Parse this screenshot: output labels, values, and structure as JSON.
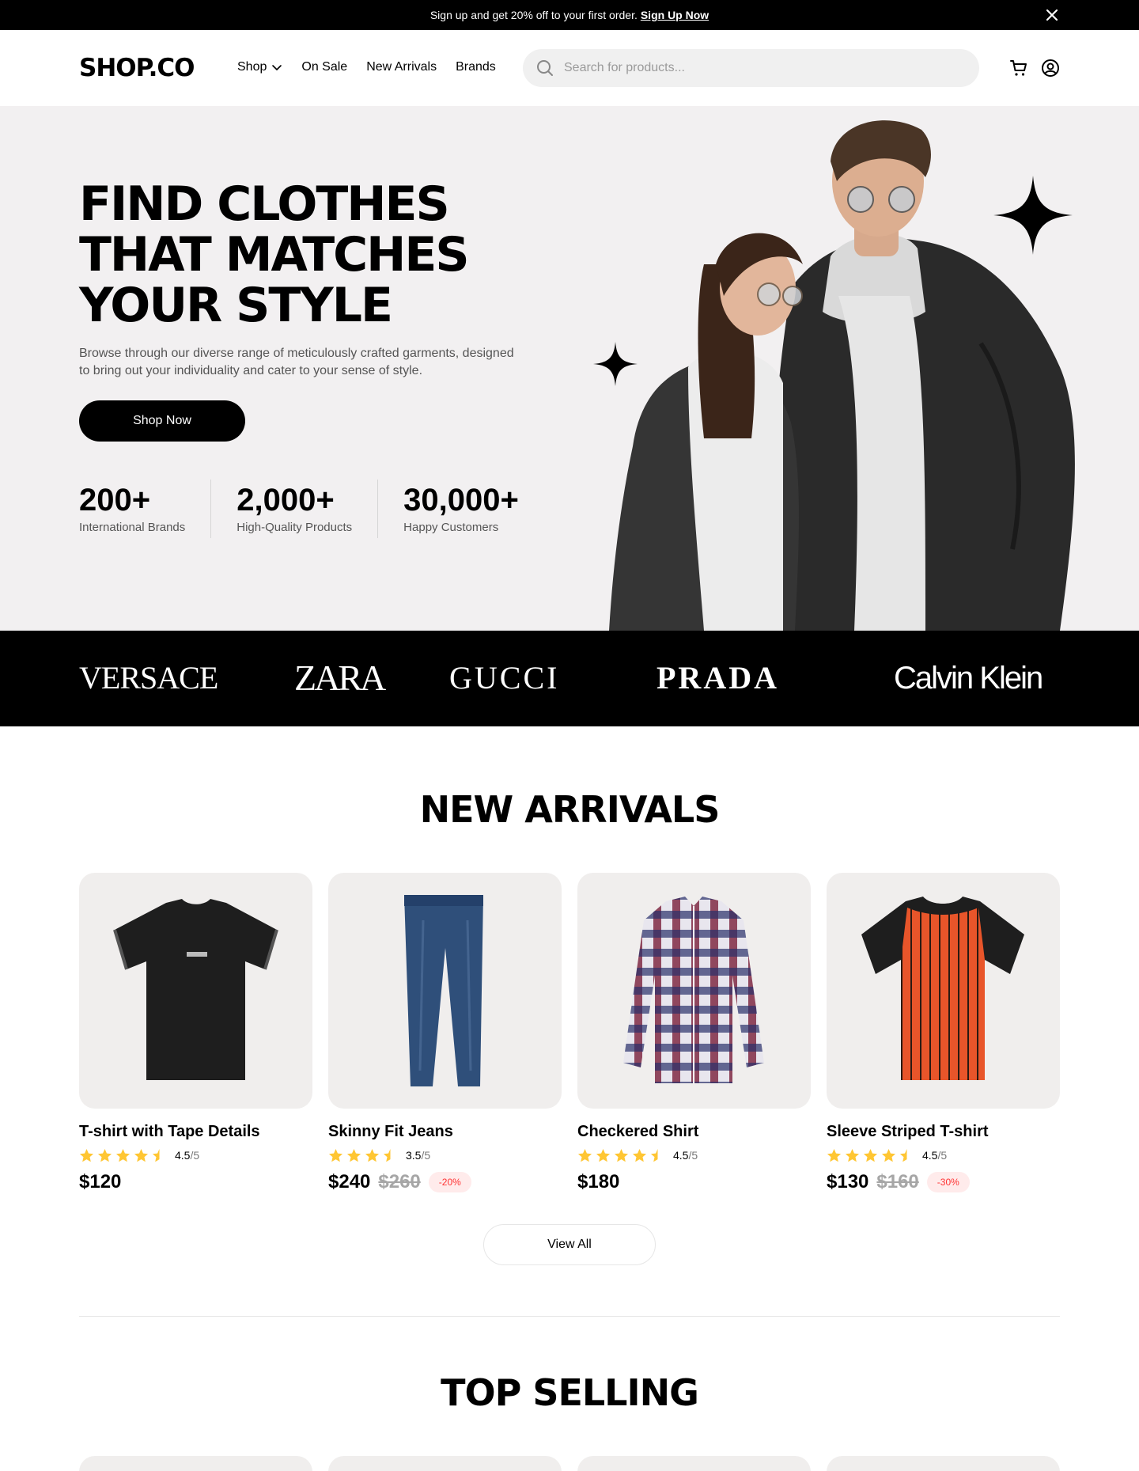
{
  "announcement": {
    "text": "Sign up and get 20% off to your first order.",
    "link": "Sign Up Now"
  },
  "header": {
    "logo": "SHOP.CO",
    "nav": [
      "Shop",
      "On Sale",
      "New Arrivals",
      "Brands"
    ],
    "search_placeholder": "Search for products..."
  },
  "hero": {
    "title_lines": [
      "FIND CLOTHES",
      "THAT MATCHES",
      "YOUR STYLE"
    ],
    "subtitle": "Browse through our diverse range of meticulously crafted garments, designed to bring out your individuality and cater to your sense of style.",
    "cta": "Shop Now",
    "stats": [
      {
        "value": "200+",
        "label": "International Brands"
      },
      {
        "value": "2,000+",
        "label": "High-Quality Products"
      },
      {
        "value": "30,000+",
        "label": "Happy Customers"
      }
    ]
  },
  "brands": [
    "VERSACE",
    "ZARA",
    "GUCCI",
    "PRADA",
    "Calvin Klein"
  ],
  "new_arrivals": {
    "title": "NEW ARRIVALS",
    "products": [
      {
        "name": "T-shirt with Tape Details",
        "rating": 4.5,
        "rating_value": "4.5",
        "rating_max": "/5",
        "price": "$120",
        "old_price": "",
        "discount": ""
      },
      {
        "name": "Skinny Fit Jeans",
        "rating": 3.5,
        "rating_value": "3.5",
        "rating_max": "/5",
        "price": "$240",
        "old_price": "$260",
        "discount": "-20%"
      },
      {
        "name": "Checkered Shirt",
        "rating": 4.5,
        "rating_value": "4.5",
        "rating_max": "/5",
        "price": "$180",
        "old_price": "",
        "discount": ""
      },
      {
        "name": "Sleeve Striped T-shirt",
        "rating": 4.5,
        "rating_value": "4.5",
        "rating_max": "/5",
        "price": "$130",
        "old_price": "$160",
        "discount": "-30%"
      }
    ],
    "view_all": "View All"
  },
  "top_selling": {
    "title": "TOP SELLING"
  },
  "colors": {
    "accent": "#000000",
    "hero_bg": "#f2f0f1",
    "card_bg": "#f0eeed",
    "star": "#ffc633",
    "discount_text": "#ff3333",
    "discount_bg": "#ffebeb"
  }
}
